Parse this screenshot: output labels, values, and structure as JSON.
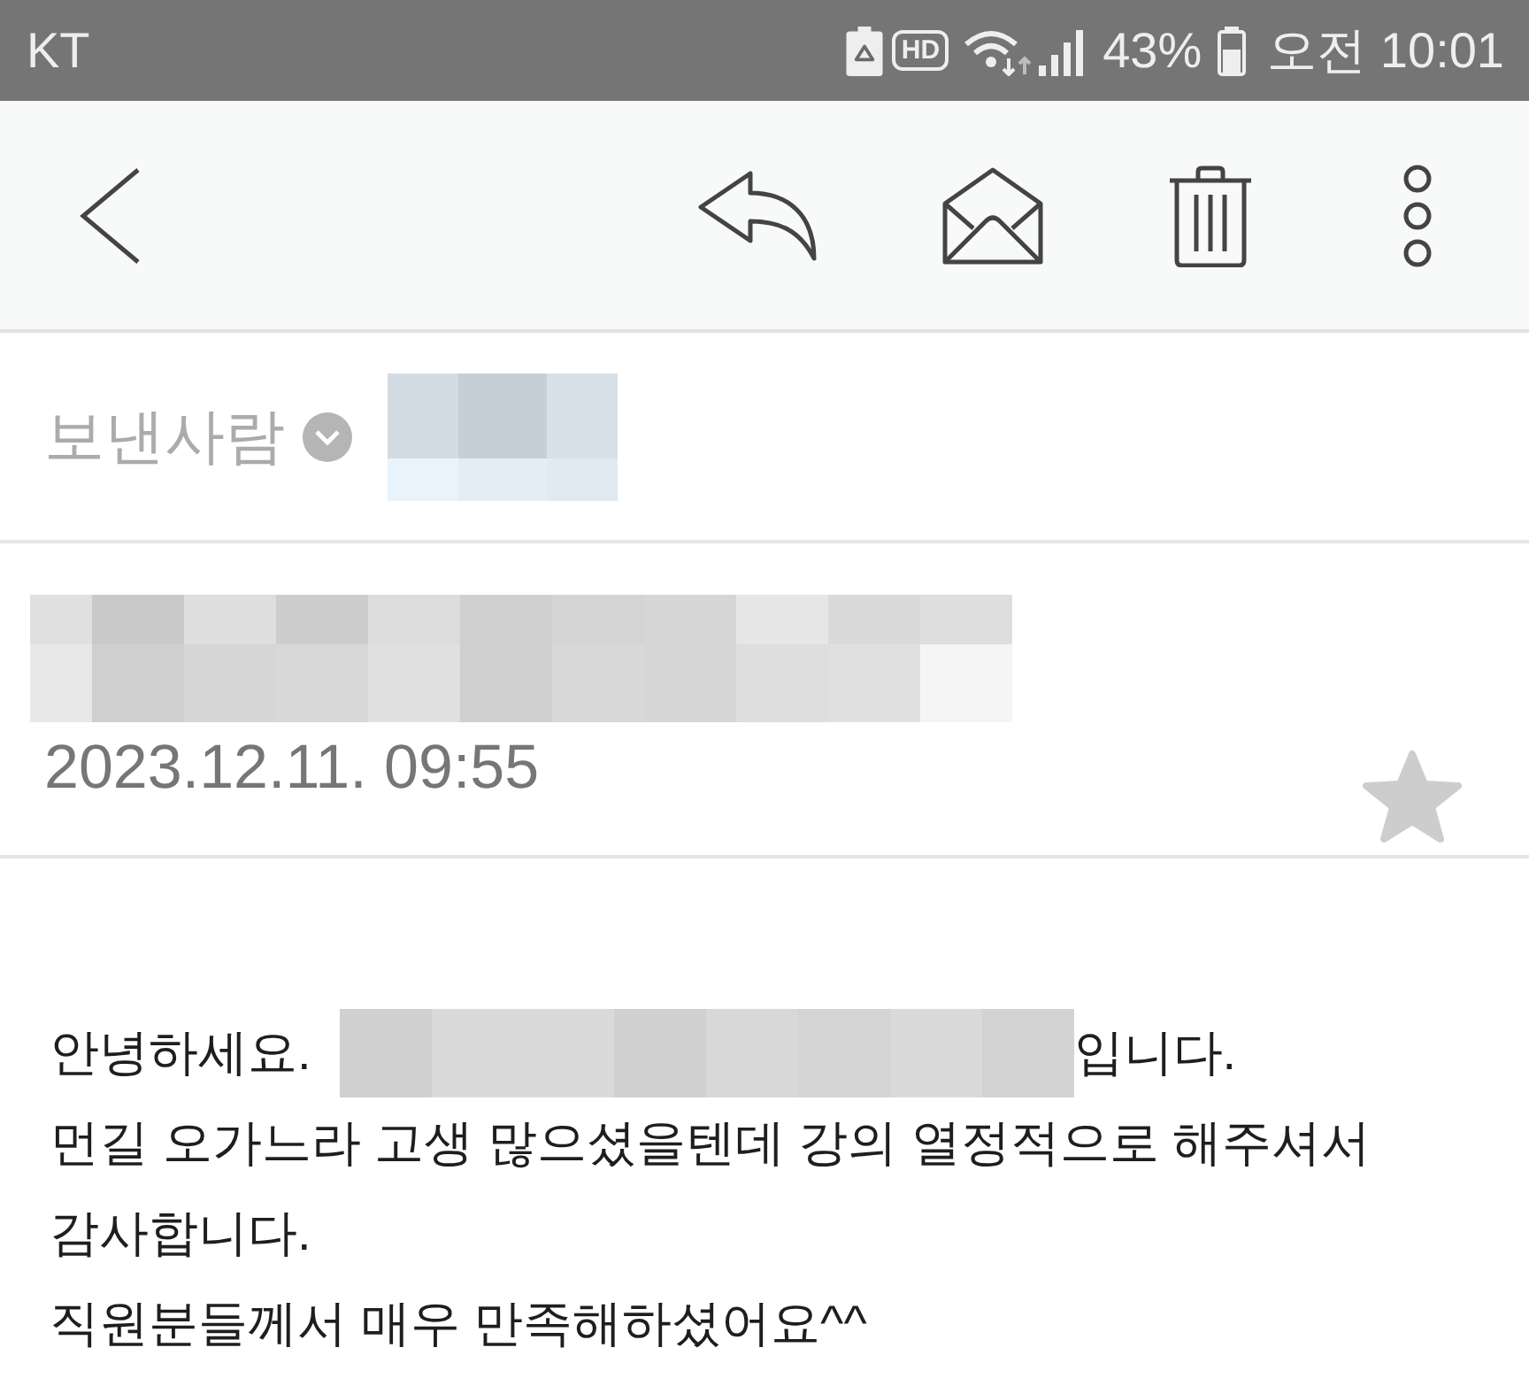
{
  "status_bar": {
    "carrier": "KT",
    "hd_badge": "HD",
    "battery_percent": "43%",
    "time": "오전 10:01"
  },
  "sender": {
    "label": "보낸사람"
  },
  "message": {
    "date": "2023.12.11. 09:55",
    "starred": false
  },
  "body": {
    "intro": [
      {
        "kind": "text",
        "text": "안녕하세요."
      },
      {
        "kind": "redacted"
      },
      {
        "kind": "text",
        "text": "입니다."
      }
    ],
    "paragraphs": [
      "먼길 오가느라 고생 많으셨을텐데 강의 열정적으로 해주셔서 감사합니다.",
      "직원분들께서 매우 만족해하셨어요^^"
    ]
  }
}
